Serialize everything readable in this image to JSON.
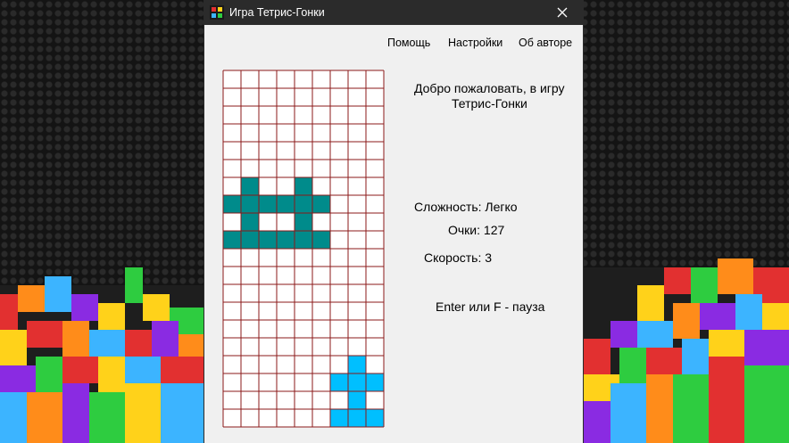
{
  "window": {
    "title": "Игра Тетрис-Гонки",
    "icon": "tetris-app-icon",
    "close_icon": "close-icon"
  },
  "menu": {
    "help": "Помощь",
    "settings": "Настройки",
    "about": "Об авторе"
  },
  "info": {
    "welcome_line1": "Добро пожаловать, в игру",
    "welcome_line2": "Тетрис-Гонки",
    "difficulty": "Сложность: Легко",
    "score": "Очки: 127",
    "speed": "Скорость: 3",
    "pause_hint": "Enter или F - пауза"
  },
  "board": {
    "columns": 9,
    "rows": 20,
    "grid_color": "#8b1a1a",
    "empty_color": "#ffffff",
    "player_car": {
      "color": "#008b8b",
      "cells": [
        [
          1,
          6
        ],
        [
          4,
          6
        ],
        [
          0,
          7
        ],
        [
          1,
          7
        ],
        [
          2,
          7
        ],
        [
          3,
          7
        ],
        [
          4,
          7
        ],
        [
          5,
          7
        ],
        [
          1,
          8
        ],
        [
          4,
          8
        ],
        [
          0,
          9
        ],
        [
          1,
          9
        ],
        [
          2,
          9
        ],
        [
          3,
          9
        ],
        [
          4,
          9
        ],
        [
          5,
          9
        ]
      ]
    },
    "obstacle_car": {
      "color": "#00bfff",
      "cells": [
        [
          7,
          16
        ],
        [
          6,
          17
        ],
        [
          7,
          17
        ],
        [
          8,
          17
        ],
        [
          7,
          18
        ],
        [
          6,
          19
        ],
        [
          7,
          19
        ],
        [
          8,
          19
        ]
      ]
    }
  },
  "colors": {
    "titlebar": "#2b2b2b",
    "window_bg": "#f0f0f0"
  }
}
